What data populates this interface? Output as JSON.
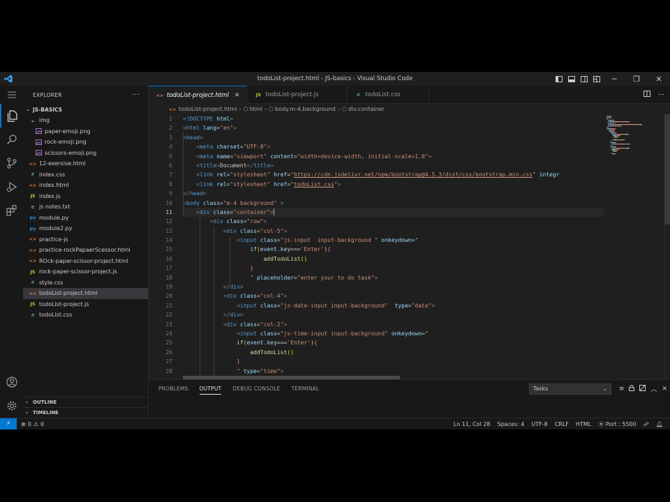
{
  "window": {
    "title": "todoList-project.html - JS-basics - Visual Studio Code"
  },
  "sidebar": {
    "header": "EXPLORER",
    "root": "JS-BASICS",
    "items": [
      {
        "label": "img",
        "icon": "folder-open-icon",
        "indent": 1,
        "badge": ""
      },
      {
        "label": "paper-emoji.png",
        "icon": "image-file-icon",
        "indent": 2,
        "badge": ""
      },
      {
        "label": "rock-emoji.png",
        "icon": "image-file-icon",
        "indent": 2,
        "badge": ""
      },
      {
        "label": "scissors-emoji.png",
        "icon": "image-file-icon",
        "indent": 2,
        "badge": ""
      },
      {
        "label": "12-exersise.html",
        "icon": "html-file-icon",
        "indent": 1,
        "badge": "<>"
      },
      {
        "label": "index.css",
        "icon": "css-file-icon",
        "indent": 1,
        "badge": "#"
      },
      {
        "label": "index.html",
        "icon": "html-file-icon",
        "indent": 1,
        "badge": "<>"
      },
      {
        "label": "index.js",
        "icon": "js-file-icon",
        "indent": 1,
        "badge": "JS"
      },
      {
        "label": "js notes.txt",
        "icon": "text-file-icon",
        "indent": 1,
        "badge": "≡"
      },
      {
        "label": "module.py",
        "icon": "python-file-icon",
        "indent": 1,
        "badge": "py"
      },
      {
        "label": "module2.py",
        "icon": "python-file-icon",
        "indent": 1,
        "badge": "py"
      },
      {
        "label": "practice-js",
        "icon": "html-file-icon",
        "indent": 1,
        "badge": "<>"
      },
      {
        "label": "practice-rockPapaerScessor.html",
        "icon": "html-file-icon",
        "indent": 1,
        "badge": "<>"
      },
      {
        "label": "ROck-paper-scissor-project.html",
        "icon": "html-file-icon",
        "indent": 1,
        "badge": "<>"
      },
      {
        "label": "rock-paper-scissor-project.js",
        "icon": "js-file-icon",
        "indent": 1,
        "badge": "JS"
      },
      {
        "label": "style.css",
        "icon": "css-file-icon",
        "indent": 1,
        "badge": "#"
      },
      {
        "label": "todoList-project.html",
        "icon": "html-file-icon",
        "indent": 1,
        "badge": "<>"
      },
      {
        "label": "todoList-project.js",
        "icon": "js-file-icon",
        "indent": 1,
        "badge": "JS"
      },
      {
        "label": "todoList.css",
        "icon": "css-file-icon",
        "indent": 1,
        "badge": "#"
      }
    ],
    "selected_index": 16,
    "outline": "OUTLINE",
    "timeline": "TIMELINE"
  },
  "tabs": [
    {
      "label": "todoList-project.html",
      "icon": "html-file-icon",
      "badge": "<>",
      "active": true
    },
    {
      "label": "todoList-project.js",
      "icon": "js-file-icon",
      "badge": "JS",
      "active": false
    },
    {
      "label": "todoList.css",
      "icon": "css-file-icon",
      "badge": "#",
      "active": false
    }
  ],
  "breadcrumb": [
    "todoList-project.html",
    "html",
    "body.m-4.background",
    "div.container"
  ],
  "editor": {
    "current_line": 11,
    "lines": [
      [
        [
          "pu",
          "<"
        ],
        [
          "tg",
          "!DOCTYPE"
        ],
        [
          "tx",
          " "
        ],
        [
          "at",
          "html"
        ],
        [
          "pu",
          ">"
        ]
      ],
      [
        [
          "pu",
          "<"
        ],
        [
          "tg",
          "html"
        ],
        [
          "tx",
          " "
        ],
        [
          "at",
          "lang"
        ],
        [
          "tx",
          "="
        ],
        [
          "st",
          "\"en\""
        ],
        [
          "pu",
          ">"
        ]
      ],
      [
        [
          "pu",
          "<"
        ],
        [
          "tg",
          "head"
        ],
        [
          "pu",
          ">"
        ]
      ],
      [
        [
          "tx",
          "    "
        ],
        [
          "pu",
          "<"
        ],
        [
          "tg",
          "meta"
        ],
        [
          "tx",
          " "
        ],
        [
          "at",
          "charset"
        ],
        [
          "tx",
          "="
        ],
        [
          "st",
          "\"UTF-8\""
        ],
        [
          "pu",
          ">"
        ]
      ],
      [
        [
          "tx",
          "    "
        ],
        [
          "pu",
          "<"
        ],
        [
          "tg",
          "meta"
        ],
        [
          "tx",
          " "
        ],
        [
          "at",
          "name"
        ],
        [
          "tx",
          "="
        ],
        [
          "st",
          "\"viewport\""
        ],
        [
          "tx",
          " "
        ],
        [
          "at",
          "content"
        ],
        [
          "tx",
          "="
        ],
        [
          "st",
          "\"width=device-width, initial-scale=1.0\""
        ],
        [
          "pu",
          ">"
        ]
      ],
      [
        [
          "tx",
          "    "
        ],
        [
          "pu",
          "<"
        ],
        [
          "tg",
          "title"
        ],
        [
          "pu",
          ">"
        ],
        [
          "tx",
          "Document"
        ],
        [
          "pu",
          "</"
        ],
        [
          "tg",
          "title"
        ],
        [
          "pu",
          ">"
        ]
      ],
      [
        [
          "tx",
          "    "
        ],
        [
          "pu",
          "<"
        ],
        [
          "tg",
          "link"
        ],
        [
          "tx",
          " "
        ],
        [
          "at",
          "rel"
        ],
        [
          "tx",
          "="
        ],
        [
          "st",
          "\"stylesheet\""
        ],
        [
          "tx",
          " "
        ],
        [
          "at",
          "href"
        ],
        [
          "tx",
          "="
        ],
        [
          "st",
          "\""
        ],
        [
          "stu",
          "https://cdn.jsdelivr.net/npm/bootstrap@4.5.3/dist/css/bootstrap.min.css"
        ],
        [
          "st",
          "\""
        ],
        [
          "tx",
          " "
        ],
        [
          "at",
          "integr"
        ]
      ],
      [
        [
          "tx",
          "    "
        ],
        [
          "pu",
          "<"
        ],
        [
          "tg",
          "link"
        ],
        [
          "tx",
          " "
        ],
        [
          "at",
          "rel"
        ],
        [
          "tx",
          "="
        ],
        [
          "st",
          "\"stylesheet\""
        ],
        [
          "tx",
          " "
        ],
        [
          "at",
          "href"
        ],
        [
          "tx",
          "="
        ],
        [
          "st",
          "\""
        ],
        [
          "stu",
          "todoList.css"
        ],
        [
          "st",
          "\""
        ],
        [
          "pu",
          ">"
        ]
      ],
      [
        [
          "pu",
          "</"
        ],
        [
          "tg",
          "head"
        ],
        [
          "pu",
          ">"
        ]
      ],
      [
        [
          "pu",
          "<"
        ],
        [
          "tg",
          "body"
        ],
        [
          "tx",
          " "
        ],
        [
          "at",
          "class"
        ],
        [
          "tx",
          "="
        ],
        [
          "st",
          "\"m-4 background\""
        ],
        [
          "tx",
          " "
        ],
        [
          "pu",
          ">"
        ]
      ],
      [
        [
          "tx",
          "    "
        ],
        [
          "pu",
          "<"
        ],
        [
          "tg",
          "div"
        ],
        [
          "tx",
          " "
        ],
        [
          "at",
          "class"
        ],
        [
          "tx",
          "="
        ],
        [
          "st",
          "\"container\""
        ],
        [
          "pu",
          ">"
        ]
      ],
      [
        [
          "tx",
          "        "
        ],
        [
          "pu",
          "<"
        ],
        [
          "tg",
          "div"
        ],
        [
          "tx",
          " "
        ],
        [
          "at",
          "class"
        ],
        [
          "tx",
          "="
        ],
        [
          "st",
          "\"row\""
        ],
        [
          "pu",
          ">"
        ]
      ],
      [
        [
          "tx",
          "            "
        ],
        [
          "pu",
          "<"
        ],
        [
          "tg",
          "div"
        ],
        [
          "tx",
          " "
        ],
        [
          "at",
          "class"
        ],
        [
          "tx",
          "="
        ],
        [
          "st",
          "\"col-5\""
        ],
        [
          "pu",
          ">"
        ]
      ],
      [
        [
          "tx",
          "                "
        ],
        [
          "pu",
          "<"
        ],
        [
          "tg",
          "input"
        ],
        [
          "tx",
          " "
        ],
        [
          "at",
          "class"
        ],
        [
          "tx",
          "="
        ],
        [
          "st",
          "\"js-input  input-background \""
        ],
        [
          "tx",
          " "
        ],
        [
          "at",
          "onkeydown"
        ],
        [
          "tx",
          "="
        ],
        [
          "st",
          "\""
        ]
      ],
      [
        [
          "tx",
          "                    "
        ],
        [
          "at",
          "if"
        ],
        [
          "br",
          "("
        ],
        [
          "at",
          "event"
        ],
        [
          "tx",
          "."
        ],
        [
          "at",
          "key"
        ],
        [
          "tx",
          "==="
        ],
        [
          "st",
          "'Enter'"
        ],
        [
          "br",
          ")"
        ],
        [
          "br2",
          "{"
        ]
      ],
      [
        [
          "tx",
          "                        "
        ],
        [
          "fn",
          "addTodoList"
        ],
        [
          "br",
          "()"
        ]
      ],
      [
        [
          "tx",
          "                    "
        ],
        [
          "br2",
          "}"
        ]
      ],
      [
        [
          "tx",
          "                    "
        ],
        [
          "st",
          "\""
        ],
        [
          "tx",
          " "
        ],
        [
          "at",
          "placeholder"
        ],
        [
          "tx",
          "="
        ],
        [
          "st",
          "\"enter your to do task\""
        ],
        [
          "pu",
          ">"
        ]
      ],
      [
        [
          "tx",
          "            "
        ],
        [
          "pu",
          "</"
        ],
        [
          "tg",
          "div"
        ],
        [
          "pu",
          ">"
        ]
      ],
      [
        [
          "tx",
          "            "
        ],
        [
          "pu",
          "<"
        ],
        [
          "tg",
          "div"
        ],
        [
          "tx",
          " "
        ],
        [
          "at",
          "class"
        ],
        [
          "tx",
          "="
        ],
        [
          "st",
          "\"col-4\""
        ],
        [
          "pu",
          ">"
        ]
      ],
      [
        [
          "tx",
          "                "
        ],
        [
          "pu",
          "<"
        ],
        [
          "tg",
          "input"
        ],
        [
          "tx",
          " "
        ],
        [
          "at",
          "class"
        ],
        [
          "tx",
          "="
        ],
        [
          "st",
          "\"js-date-input input-background\""
        ],
        [
          "tx",
          "  "
        ],
        [
          "at",
          "type"
        ],
        [
          "tx",
          "="
        ],
        [
          "st",
          "\"date\""
        ],
        [
          "pu",
          ">"
        ]
      ],
      [
        [
          "tx",
          "            "
        ],
        [
          "pu",
          "</"
        ],
        [
          "tg",
          "div"
        ],
        [
          "pu",
          ">"
        ]
      ],
      [
        [
          "tx",
          "            "
        ],
        [
          "pu",
          "<"
        ],
        [
          "tg",
          "div"
        ],
        [
          "tx",
          " "
        ],
        [
          "at",
          "class"
        ],
        [
          "tx",
          "="
        ],
        [
          "st",
          "\"col-2\""
        ],
        [
          "pu",
          ">"
        ]
      ],
      [
        [
          "tx",
          "                "
        ],
        [
          "pu",
          "<"
        ],
        [
          "tg",
          "input"
        ],
        [
          "tx",
          " "
        ],
        [
          "at",
          "class"
        ],
        [
          "tx",
          "="
        ],
        [
          "st",
          "\"js-time-input input-background\""
        ],
        [
          "tx",
          " "
        ],
        [
          "at",
          "onkeydown"
        ],
        [
          "tx",
          "="
        ],
        [
          "st",
          "\""
        ]
      ],
      [
        [
          "tx",
          "                "
        ],
        [
          "at",
          "if"
        ],
        [
          "br",
          "("
        ],
        [
          "at",
          "event"
        ],
        [
          "tx",
          "."
        ],
        [
          "at",
          "key"
        ],
        [
          "tx",
          "==="
        ],
        [
          "st",
          "'Enter'"
        ],
        [
          "br",
          ")"
        ],
        [
          "br2",
          "{"
        ]
      ],
      [
        [
          "tx",
          "                    "
        ],
        [
          "fn",
          "addTodoList"
        ],
        [
          "br",
          "()"
        ]
      ],
      [
        [
          "tx",
          "                "
        ],
        [
          "br2",
          "}"
        ]
      ],
      [
        [
          "tx",
          "                "
        ],
        [
          "st",
          "\""
        ],
        [
          "tx",
          " "
        ],
        [
          "at",
          "type"
        ],
        [
          "tx",
          "="
        ],
        [
          "st",
          "\"time\""
        ],
        [
          "pu",
          ">"
        ]
      ]
    ]
  },
  "panel": {
    "tabs": [
      "PROBLEMS",
      "OUTPUT",
      "DEBUG CONSOLE",
      "TERMINAL"
    ],
    "active_tab": "OUTPUT",
    "tasks_select": "Tasks"
  },
  "statusbar": {
    "errors": "0",
    "warnings": "0",
    "position": "Ln 11, Col 28",
    "spaces": "Spaces: 4",
    "encoding": "UTF-8",
    "eol": "CRLF",
    "language": "HTML",
    "port": "Port : 5500"
  },
  "colors": {
    "accent": "#0078d4",
    "html_icon": "#e37933",
    "css_icon": "#519aba",
    "js_icon": "#cbcb41",
    "py_icon": "#3b8dd1"
  }
}
